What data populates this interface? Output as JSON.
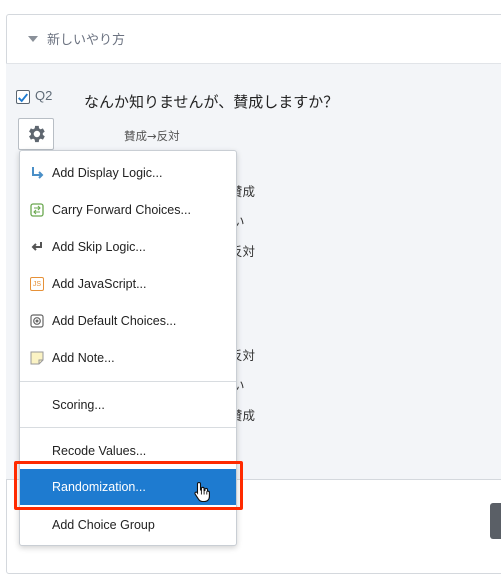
{
  "block": {
    "title": "新しいやり方"
  },
  "question": {
    "id": "Q2",
    "text": "なんか知りませんが、賛成しますか？",
    "scale_header": "賛成→反対",
    "choices": [
      "賛成",
      "い",
      "反対",
      "反対",
      "い",
      "賛成"
    ]
  },
  "menu": {
    "items": [
      {
        "label": "Add Display Logic...",
        "icon": "display-logic-icon"
      },
      {
        "label": "Carry Forward Choices...",
        "icon": "carry-forward-icon"
      },
      {
        "label": "Add Skip Logic...",
        "icon": "skip-logic-icon"
      },
      {
        "label": "Add JavaScript...",
        "icon": "javascript-icon"
      },
      {
        "label": "Add Default Choices...",
        "icon": "default-choices-icon"
      },
      {
        "label": "Add Note...",
        "icon": "note-icon"
      }
    ],
    "scoring": "Scoring...",
    "recode": "Recode Values...",
    "randomization": "Randomization...",
    "choice_group": "Add Choice Group",
    "js_badge": "JS"
  },
  "colors": {
    "accent": "#1e7bd0",
    "highlight": "#ff2a00",
    "check": "#1e7bd0"
  }
}
